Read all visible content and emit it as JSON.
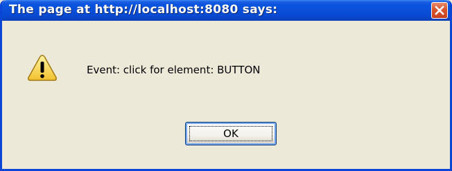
{
  "dialog": {
    "title": "The page at http://localhost:8080 says:",
    "message": "Event: click for element: BUTTON",
    "ok_label": "OK",
    "icon": "warning-icon",
    "close_icon": "close-icon"
  },
  "colors": {
    "titlebar": "#0a4fd8",
    "frame": "#0a46d6",
    "body": "#ece9d8",
    "close_button": "#d8572f",
    "warning_yellow": "#f7d248"
  }
}
